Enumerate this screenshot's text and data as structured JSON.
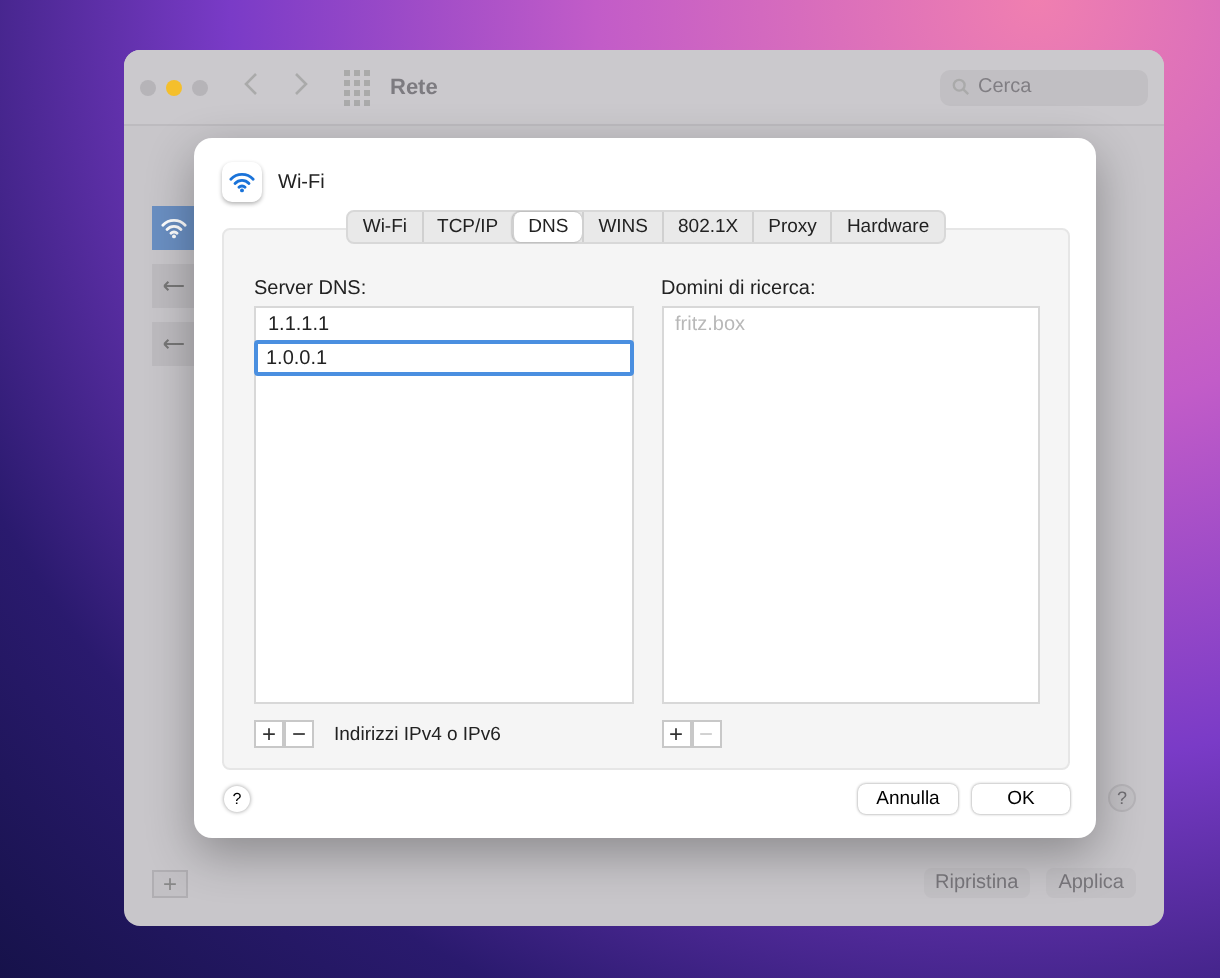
{
  "window": {
    "title": "Rete",
    "search": {
      "placeholder": "Cerca"
    },
    "sidebar": [
      {
        "kind": "wifi",
        "selected": true
      },
      {
        "kind": "ethernet",
        "selected": false
      },
      {
        "kind": "ethernet",
        "selected": false
      }
    ],
    "add_button": "+",
    "help_button": "?",
    "buttons": [
      {
        "label": "Ripristina",
        "disabled": true
      },
      {
        "label": "Applica",
        "disabled": true
      }
    ]
  },
  "sheet": {
    "title": "Wi-Fi",
    "tabs": [
      {
        "label": "Wi-Fi",
        "selected": false
      },
      {
        "label": "TCP/IP",
        "selected": false
      },
      {
        "label": "DNS",
        "selected": true
      },
      {
        "label": "WINS",
        "selected": false
      },
      {
        "label": "802.1X",
        "selected": false
      },
      {
        "label": "Proxy",
        "selected": false
      },
      {
        "label": "Hardware",
        "selected": false
      }
    ],
    "dns_servers": {
      "label": "Server DNS:",
      "entries": [
        {
          "value": "1.1.1.1",
          "editing": false
        },
        {
          "value": "1.0.0.1",
          "editing": true
        }
      ],
      "add": "+",
      "remove": "−",
      "remove_disabled": false,
      "hint": "Indirizzi IPv4 o IPv6"
    },
    "search_domains": {
      "label": "Domini di ricerca:",
      "placeholder": "fritz.box",
      "add": "+",
      "remove": "−",
      "remove_disabled": true
    },
    "help_button": "?",
    "buttons": [
      {
        "label": "Annulla",
        "kind": "cancel"
      },
      {
        "label": "OK",
        "kind": "default"
      }
    ]
  }
}
